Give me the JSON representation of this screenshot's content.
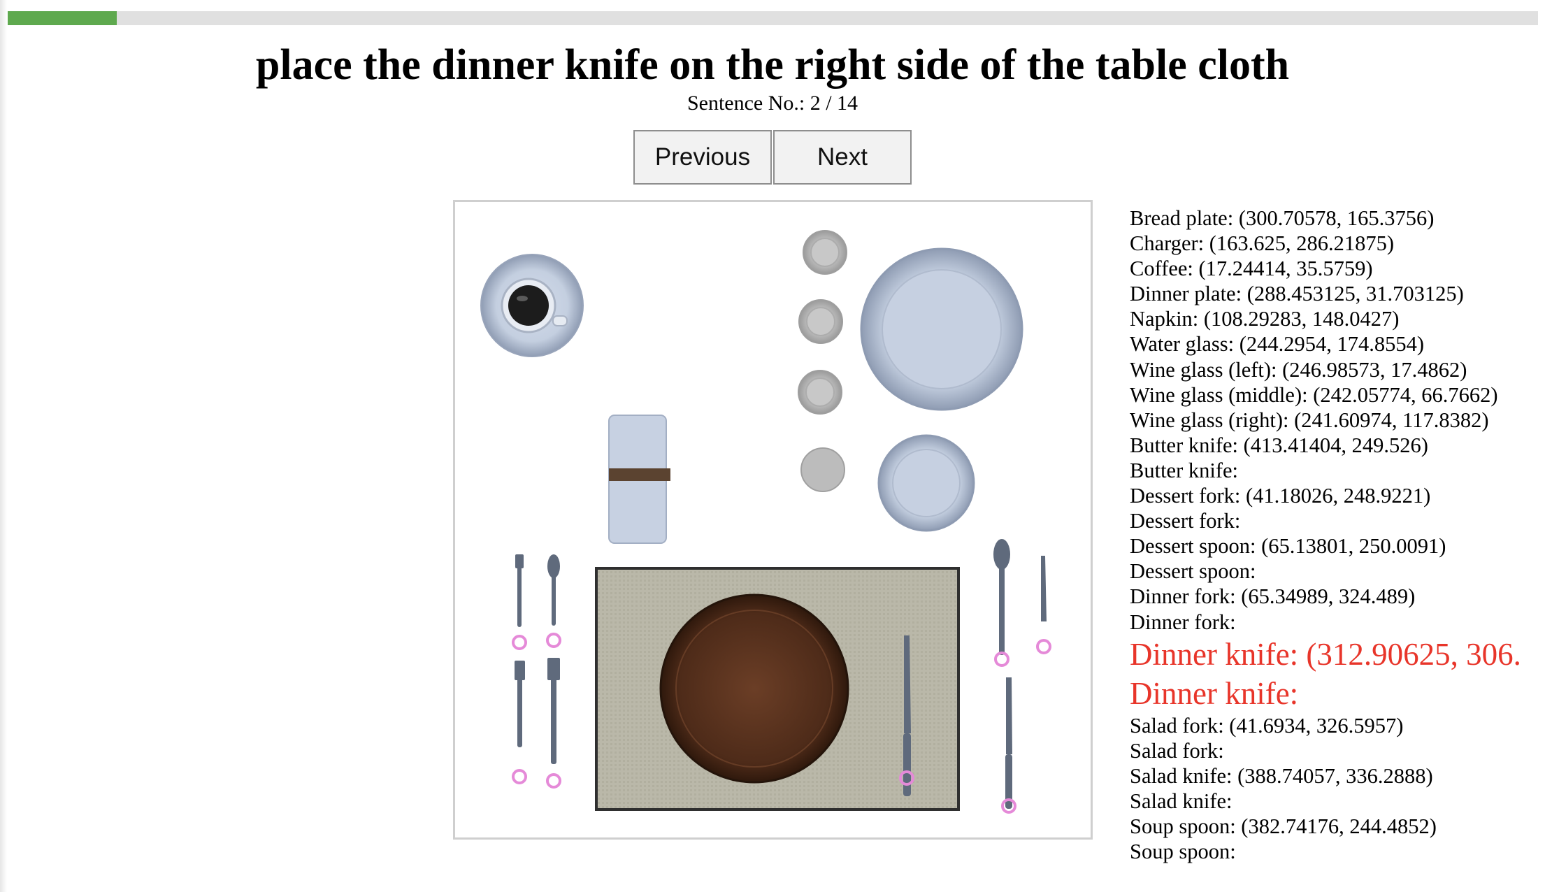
{
  "progress": {
    "fraction": 0.0714,
    "color": "#5ea94e"
  },
  "header": {
    "title": "place the dinner knife on the right side of the table cloth",
    "sentence_counter": "Sentence No.: 2 / 14"
  },
  "nav": {
    "previous_label": "Previous",
    "next_label": "Next"
  },
  "coordinates": [
    {
      "text": "Bread plate: (300.70578, 165.3756)",
      "highlight": false
    },
    {
      "text": "Charger: (163.625, 286.21875)",
      "highlight": false
    },
    {
      "text": "Coffee: (17.24414, 35.5759)",
      "highlight": false
    },
    {
      "text": "Dinner plate: (288.453125, 31.703125)",
      "highlight": false
    },
    {
      "text": "Napkin: (108.29283, 148.0427)",
      "highlight": false
    },
    {
      "text": "Water glass: (244.2954, 174.8554)",
      "highlight": false
    },
    {
      "text": "Wine glass (left): (246.98573, 17.4862)",
      "highlight": false
    },
    {
      "text": "Wine glass (middle): (242.05774, 66.7662)",
      "highlight": false
    },
    {
      "text": "Wine glass (right): (241.60974, 117.8382)",
      "highlight": false
    },
    {
      "text": "Butter knife: (413.41404, 249.526)",
      "highlight": false
    },
    {
      "text": "Butter knife:",
      "highlight": false
    },
    {
      "text": "Dessert fork: (41.18026, 248.9221)",
      "highlight": false
    },
    {
      "text": "Dessert fork:",
      "highlight": false
    },
    {
      "text": "Dessert spoon: (65.13801, 250.0091)",
      "highlight": false
    },
    {
      "text": "Dessert spoon:",
      "highlight": false
    },
    {
      "text": "Dinner fork: (65.34989, 324.489)",
      "highlight": false
    },
    {
      "text": "Dinner fork:",
      "highlight": false
    },
    {
      "text": "Dinner knife: (312.90625, 306.",
      "highlight": true
    },
    {
      "text": "Dinner knife:",
      "highlight": true
    },
    {
      "text": "Salad fork: (41.6934, 326.5957)",
      "highlight": false
    },
    {
      "text": "Salad fork:",
      "highlight": false
    },
    {
      "text": "Salad knife: (388.74057, 336.2888)",
      "highlight": false
    },
    {
      "text": "Salad knife:",
      "highlight": false
    },
    {
      "text": "Soup spoon: (382.74176, 244.4852)",
      "highlight": false
    },
    {
      "text": "Soup spoon:",
      "highlight": false
    }
  ],
  "colors": {
    "highlight": "#e8352a",
    "tablecloth": "#b9b7a8",
    "charger": "#5a3422",
    "plate": "#c9d4e4",
    "cutlery": "#5f6a7c",
    "marker": "#e58ad8"
  }
}
